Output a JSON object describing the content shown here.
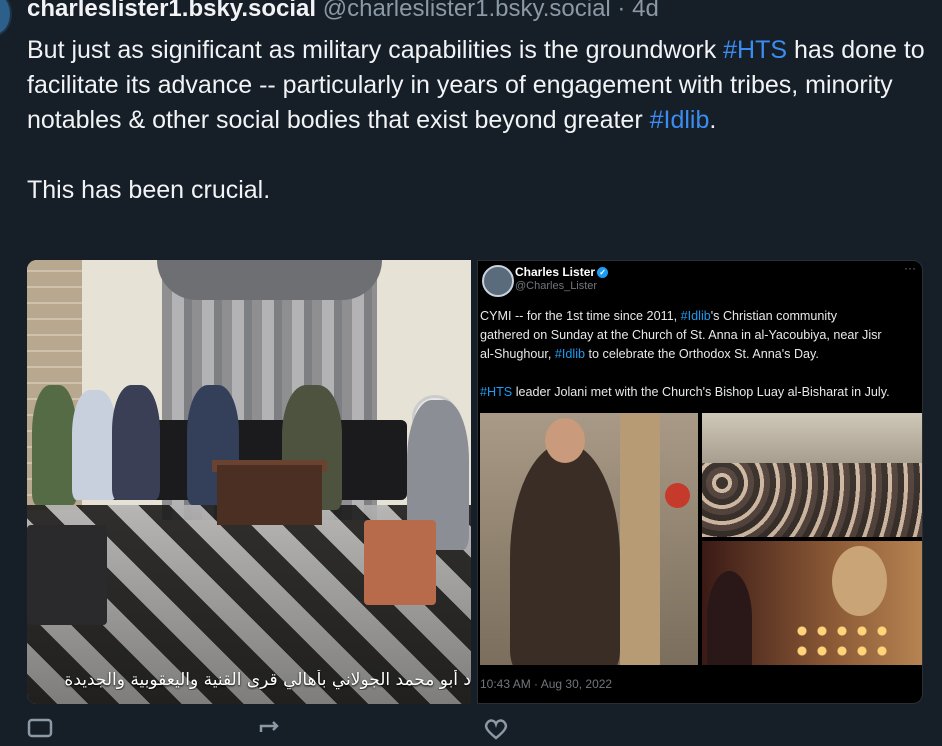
{
  "post": {
    "display_name": "charleslister1.bsky.social",
    "handle": "@charleslister1.bsky.social",
    "separator": " · ",
    "time": "4d",
    "text": {
      "line1_pre": "But just as significant as military capabilities is the groundwork ",
      "tag_hts": "#HTS",
      "line2": " has done to facilitate its advance -- particularly in years of engagement with tribes, minority notables & other social bodies that exist beyond greater ",
      "tag_idlib": "#Idlib",
      "end": ".",
      "para2": "This has been crucial."
    }
  },
  "image_left": {
    "caption": "د أبو محمد الجولاني بأهالي قرى القنية واليعقوبية والجديدة"
  },
  "image_right": {
    "name": "Charles Lister",
    "verified_mark": "✓",
    "handle": "@Charles_Lister",
    "more": "···",
    "t1a": "CYMI -- for the 1st time since 2011, ",
    "t1tag": "#Idlib",
    "t1b": "'s Christian community",
    "t2": "gathered on Sunday at the Church of St. Anna in al-Yacoubiya, near Jisr",
    "t3a": "al-Shughour, ",
    "t3tag": "#Idlib",
    "t3b": " to celebrate the Orthodox St. Anna's Day.",
    "t4tag": "#HTS",
    "t4b": " leader Jolani met with the Church's Bishop Luay al-Bisharat in July.",
    "date": "10:43 AM · Aug 30, 2022"
  },
  "actions": {
    "reply_icon": "reply-icon",
    "repost_icon": "repost-icon",
    "like_icon": "heart-icon"
  }
}
